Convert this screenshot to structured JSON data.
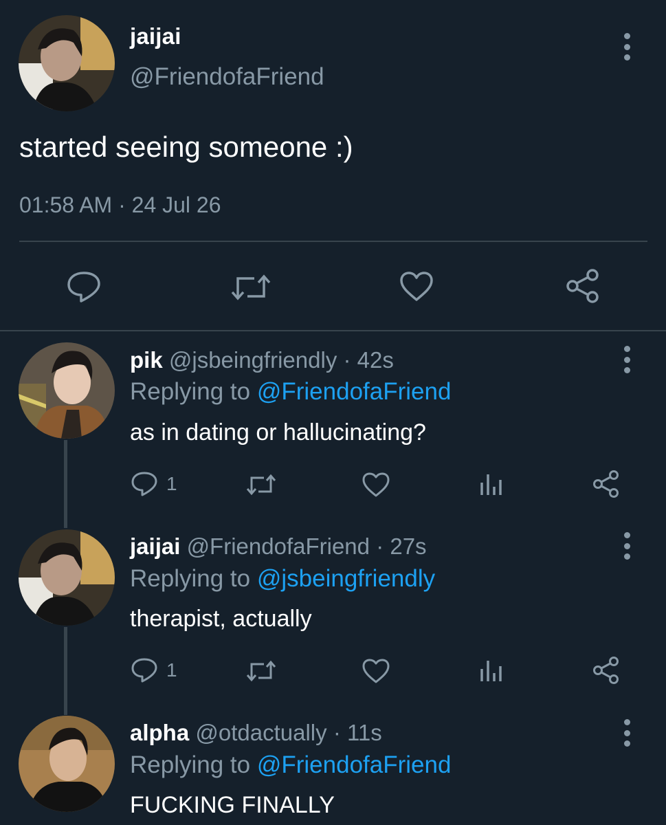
{
  "main_tweet": {
    "name": "jaijai",
    "handle": "@FriendofaFriend",
    "text": "started seeing someone :)",
    "timestamp": "01:58 AM · 24 Jul 26",
    "actions": [
      "reply-icon",
      "retweet-icon",
      "like-icon",
      "share-icon"
    ]
  },
  "replies": [
    {
      "name": "pik",
      "handle": "@jsbeingfriendly",
      "time": "· 42s",
      "replying_label": "Replying to",
      "replying_to": "@FriendofaFriend",
      "text": "as in dating or hallucinating?",
      "reply_count": "1"
    },
    {
      "name": "jaijai",
      "handle": "@FriendofaFriend",
      "time": "· 27s",
      "replying_label": "Replying to",
      "replying_to": "@jsbeingfriendly",
      "text": "therapist, actually",
      "reply_count": "1"
    },
    {
      "name": "alpha",
      "handle": "@otdactually",
      "time": "· 11s",
      "replying_label": "Replying to",
      "replying_to": "@FriendofaFriend",
      "text": "FUCKING FINALLY"
    }
  ],
  "colors": {
    "background": "#15202b",
    "secondary_text": "#8899a6",
    "mention": "#1da1f2",
    "divider": "#38444d"
  }
}
